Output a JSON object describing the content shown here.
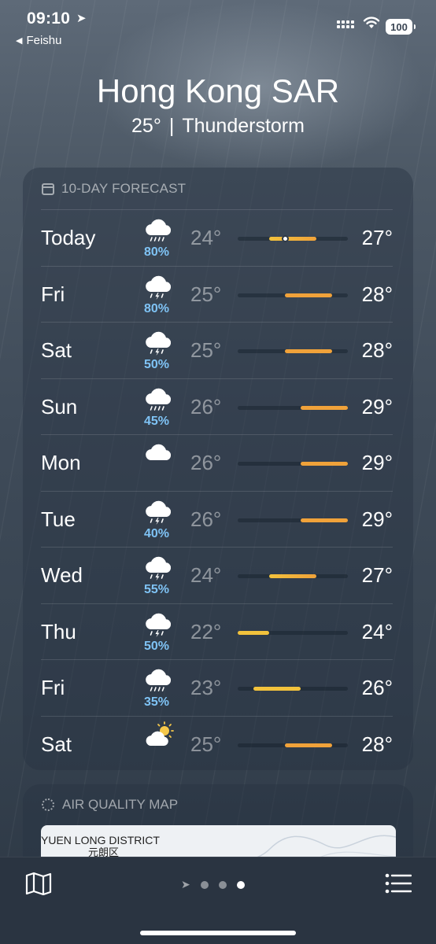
{
  "status_bar": {
    "time": "09:10",
    "back_app": "Feishu",
    "battery": "100"
  },
  "header": {
    "city": "Hong Kong SAR",
    "temperature": "25°",
    "separator": "|",
    "condition": "Thunderstorm"
  },
  "forecast": {
    "title": "10-DAY FORECAST",
    "days": [
      {
        "day": "Today",
        "icon": "rain-cloud-icon",
        "pop": "80%",
        "low": "24°",
        "high": "27°",
        "range": [
          24,
          27
        ],
        "current": 25
      },
      {
        "day": "Fri",
        "icon": "thunderstorm-icon",
        "pop": "80%",
        "low": "25°",
        "high": "28°",
        "range": [
          25,
          28
        ]
      },
      {
        "day": "Sat",
        "icon": "thunderstorm-icon",
        "pop": "50%",
        "low": "25°",
        "high": "28°",
        "range": [
          25,
          28
        ]
      },
      {
        "day": "Sun",
        "icon": "rain-cloud-icon",
        "pop": "45%",
        "low": "26°",
        "high": "29°",
        "range": [
          26,
          29
        ]
      },
      {
        "day": "Mon",
        "icon": "cloud-icon",
        "pop": "",
        "low": "26°",
        "high": "29°",
        "range": [
          26,
          29
        ]
      },
      {
        "day": "Tue",
        "icon": "thunderstorm-icon",
        "pop": "40%",
        "low": "26°",
        "high": "29°",
        "range": [
          26,
          29
        ]
      },
      {
        "day": "Wed",
        "icon": "thunderstorm-icon",
        "pop": "55%",
        "low": "24°",
        "high": "27°",
        "range": [
          24,
          27
        ]
      },
      {
        "day": "Thu",
        "icon": "thunderstorm-icon",
        "pop": "50%",
        "low": "22°",
        "high": "24°",
        "range": [
          22,
          24
        ]
      },
      {
        "day": "Fri",
        "icon": "rain-cloud-icon",
        "pop": "35%",
        "low": "23°",
        "high": "26°",
        "range": [
          23,
          26
        ]
      },
      {
        "day": "Sat",
        "icon": "partly-sunny-icon",
        "pop": "",
        "low": "25°",
        "high": "28°",
        "range": [
          25,
          28
        ]
      }
    ]
  },
  "air_quality": {
    "title": "AIR QUALITY MAP",
    "map_label": "YUEN LONG DISTRICT",
    "map_label_cn": "元朗区"
  },
  "colors": {
    "pop_text": "#7fc3f5",
    "bar_warm": "#f0a23a",
    "bar_mild": "#f2c23c"
  }
}
